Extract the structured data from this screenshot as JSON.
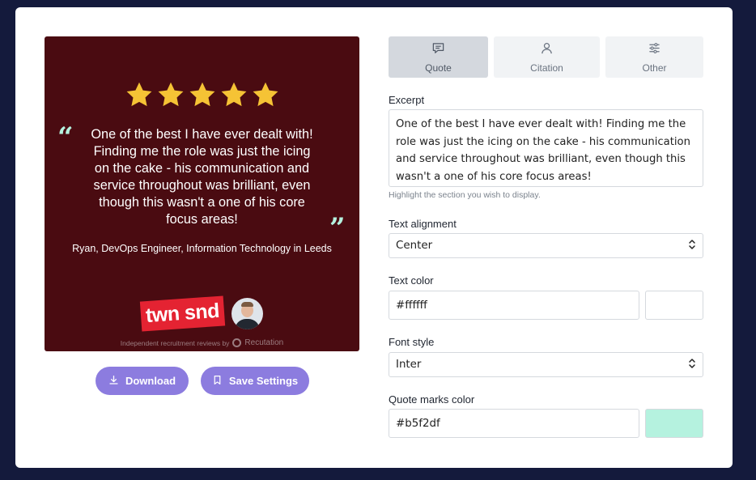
{
  "preview": {
    "quote": "One of the best I have ever dealt with! Finding me the role was just the icing on the cake - his communication and service throughout was brilliant, even though this wasn't a one of his core focus areas!",
    "quote_open": "“",
    "quote_close": "”",
    "attribution": "Ryan, DevOps Engineer, Information Technology in Leeds",
    "brand_text": "twn snd",
    "footer_note": "Independent recruitment reviews by",
    "footer_brand": "Recutation",
    "star_count": 5,
    "background_color": "#4a0b11",
    "star_color": "#f5c335",
    "quote_marks_color": "#b5f2df"
  },
  "buttons": {
    "download": "Download",
    "save": "Save Settings"
  },
  "tabs": {
    "quote": "Quote",
    "citation": "Citation",
    "other": "Other"
  },
  "form": {
    "excerpt_label": "Excerpt",
    "excerpt_value": "One of the best I have ever dealt with! Finding me the role was just the icing on the cake - his communication and service throughout was brilliant, even though this wasn't a one of his core focus areas!",
    "excerpt_help": "Highlight the section you wish to display.",
    "alignment_label": "Text alignment",
    "alignment_value": "Center",
    "text_color_label": "Text color",
    "text_color_value": "#ffffff",
    "font_style_label": "Font style",
    "font_style_value": "Inter",
    "quote_marks_label": "Quote marks color",
    "quote_marks_value": "#b5f2df"
  }
}
